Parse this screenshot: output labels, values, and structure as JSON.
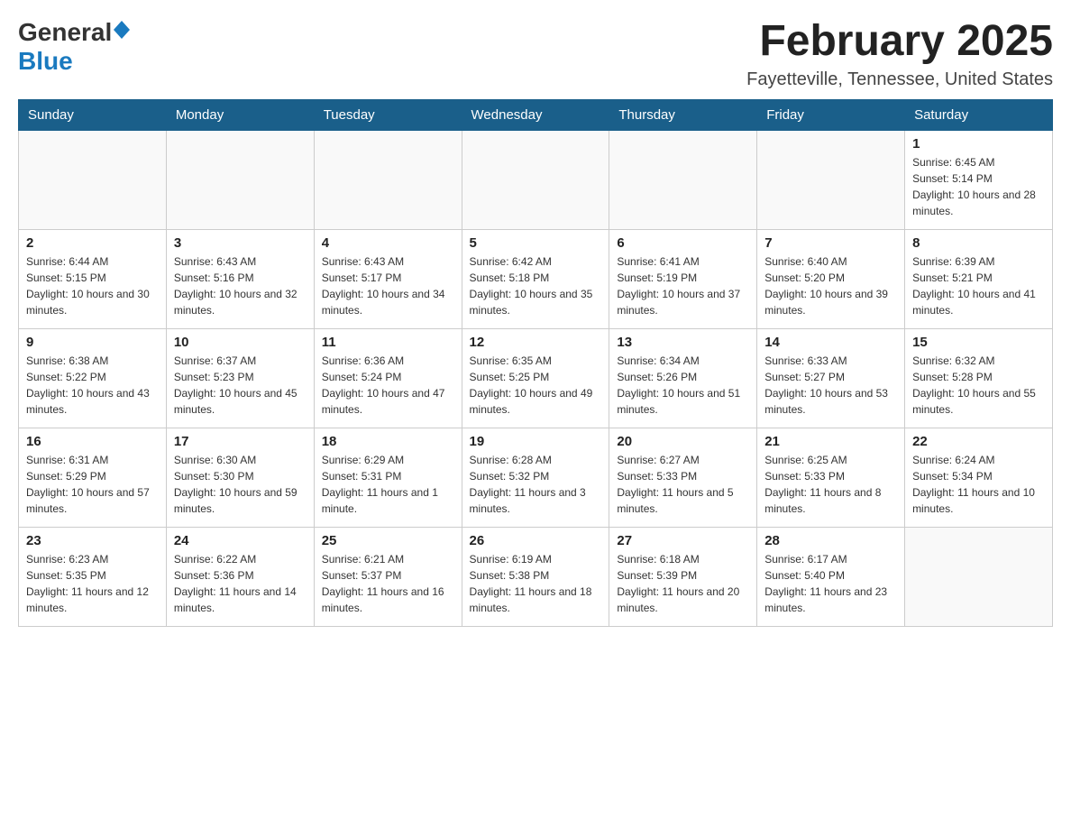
{
  "header": {
    "title": "February 2025",
    "subtitle": "Fayetteville, Tennessee, United States",
    "logo_general": "General",
    "logo_blue": "Blue"
  },
  "weekdays": [
    "Sunday",
    "Monday",
    "Tuesday",
    "Wednesday",
    "Thursday",
    "Friday",
    "Saturday"
  ],
  "weeks": [
    [
      {
        "day": "",
        "info": ""
      },
      {
        "day": "",
        "info": ""
      },
      {
        "day": "",
        "info": ""
      },
      {
        "day": "",
        "info": ""
      },
      {
        "day": "",
        "info": ""
      },
      {
        "day": "",
        "info": ""
      },
      {
        "day": "1",
        "info": "Sunrise: 6:45 AM\nSunset: 5:14 PM\nDaylight: 10 hours and 28 minutes."
      }
    ],
    [
      {
        "day": "2",
        "info": "Sunrise: 6:44 AM\nSunset: 5:15 PM\nDaylight: 10 hours and 30 minutes."
      },
      {
        "day": "3",
        "info": "Sunrise: 6:43 AM\nSunset: 5:16 PM\nDaylight: 10 hours and 32 minutes."
      },
      {
        "day": "4",
        "info": "Sunrise: 6:43 AM\nSunset: 5:17 PM\nDaylight: 10 hours and 34 minutes."
      },
      {
        "day": "5",
        "info": "Sunrise: 6:42 AM\nSunset: 5:18 PM\nDaylight: 10 hours and 35 minutes."
      },
      {
        "day": "6",
        "info": "Sunrise: 6:41 AM\nSunset: 5:19 PM\nDaylight: 10 hours and 37 minutes."
      },
      {
        "day": "7",
        "info": "Sunrise: 6:40 AM\nSunset: 5:20 PM\nDaylight: 10 hours and 39 minutes."
      },
      {
        "day": "8",
        "info": "Sunrise: 6:39 AM\nSunset: 5:21 PM\nDaylight: 10 hours and 41 minutes."
      }
    ],
    [
      {
        "day": "9",
        "info": "Sunrise: 6:38 AM\nSunset: 5:22 PM\nDaylight: 10 hours and 43 minutes."
      },
      {
        "day": "10",
        "info": "Sunrise: 6:37 AM\nSunset: 5:23 PM\nDaylight: 10 hours and 45 minutes."
      },
      {
        "day": "11",
        "info": "Sunrise: 6:36 AM\nSunset: 5:24 PM\nDaylight: 10 hours and 47 minutes."
      },
      {
        "day": "12",
        "info": "Sunrise: 6:35 AM\nSunset: 5:25 PM\nDaylight: 10 hours and 49 minutes."
      },
      {
        "day": "13",
        "info": "Sunrise: 6:34 AM\nSunset: 5:26 PM\nDaylight: 10 hours and 51 minutes."
      },
      {
        "day": "14",
        "info": "Sunrise: 6:33 AM\nSunset: 5:27 PM\nDaylight: 10 hours and 53 minutes."
      },
      {
        "day": "15",
        "info": "Sunrise: 6:32 AM\nSunset: 5:28 PM\nDaylight: 10 hours and 55 minutes."
      }
    ],
    [
      {
        "day": "16",
        "info": "Sunrise: 6:31 AM\nSunset: 5:29 PM\nDaylight: 10 hours and 57 minutes."
      },
      {
        "day": "17",
        "info": "Sunrise: 6:30 AM\nSunset: 5:30 PM\nDaylight: 10 hours and 59 minutes."
      },
      {
        "day": "18",
        "info": "Sunrise: 6:29 AM\nSunset: 5:31 PM\nDaylight: 11 hours and 1 minute."
      },
      {
        "day": "19",
        "info": "Sunrise: 6:28 AM\nSunset: 5:32 PM\nDaylight: 11 hours and 3 minutes."
      },
      {
        "day": "20",
        "info": "Sunrise: 6:27 AM\nSunset: 5:33 PM\nDaylight: 11 hours and 5 minutes."
      },
      {
        "day": "21",
        "info": "Sunrise: 6:25 AM\nSunset: 5:33 PM\nDaylight: 11 hours and 8 minutes."
      },
      {
        "day": "22",
        "info": "Sunrise: 6:24 AM\nSunset: 5:34 PM\nDaylight: 11 hours and 10 minutes."
      }
    ],
    [
      {
        "day": "23",
        "info": "Sunrise: 6:23 AM\nSunset: 5:35 PM\nDaylight: 11 hours and 12 minutes."
      },
      {
        "day": "24",
        "info": "Sunrise: 6:22 AM\nSunset: 5:36 PM\nDaylight: 11 hours and 14 minutes."
      },
      {
        "day": "25",
        "info": "Sunrise: 6:21 AM\nSunset: 5:37 PM\nDaylight: 11 hours and 16 minutes."
      },
      {
        "day": "26",
        "info": "Sunrise: 6:19 AM\nSunset: 5:38 PM\nDaylight: 11 hours and 18 minutes."
      },
      {
        "day": "27",
        "info": "Sunrise: 6:18 AM\nSunset: 5:39 PM\nDaylight: 11 hours and 20 minutes."
      },
      {
        "day": "28",
        "info": "Sunrise: 6:17 AM\nSunset: 5:40 PM\nDaylight: 11 hours and 23 minutes."
      },
      {
        "day": "",
        "info": ""
      }
    ]
  ]
}
